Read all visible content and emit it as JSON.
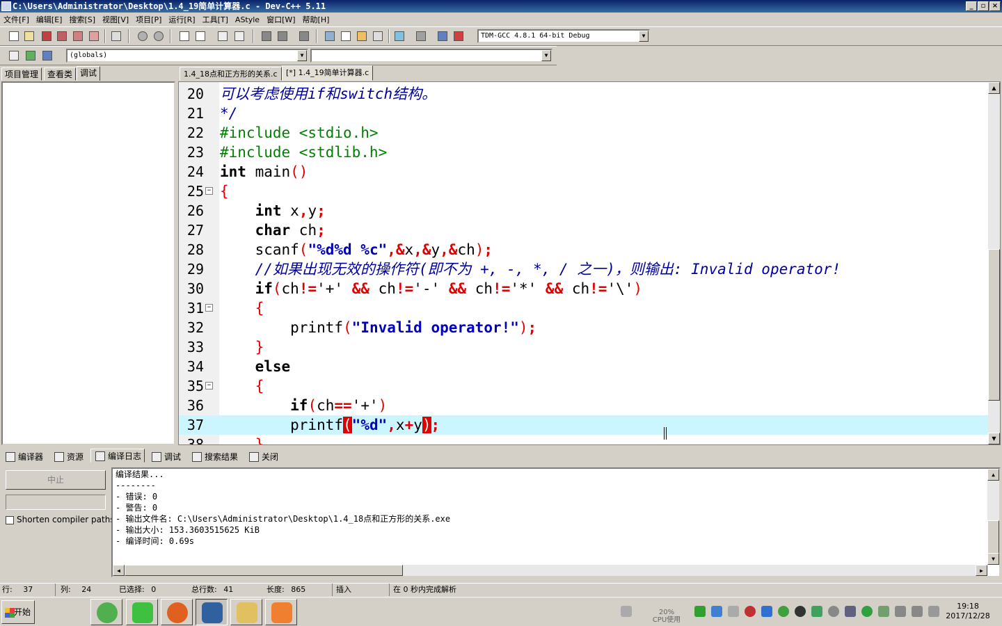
{
  "window": {
    "title": "C:\\Users\\Administrator\\Desktop\\1.4_19简单计算器.c - Dev-C++ 5.11"
  },
  "menu": [
    "文件[F]",
    "编辑[E]",
    "搜索[S]",
    "视图[V]",
    "项目[P]",
    "运行[R]",
    "工具[T]",
    "AStyle",
    "窗口[W]",
    "帮助[H]"
  ],
  "toolbar": {
    "compiler_select": "TDM-GCC 4.8.1 64-bit Debug",
    "scope_select": "(globals)",
    "member_select": ""
  },
  "left_tabs": [
    "项目管理",
    "查看类",
    "调试"
  ],
  "editor_tabs": [
    "1.4_18点和正方形的关系.c",
    "[*] 1.4_19简单计算器.c"
  ],
  "code_lines": [
    {
      "n": "20",
      "fold": ""
    },
    {
      "n": "21",
      "fold": ""
    },
    {
      "n": "22",
      "fold": ""
    },
    {
      "n": "23",
      "fold": ""
    },
    {
      "n": "24",
      "fold": ""
    },
    {
      "n": "25",
      "fold": "−"
    },
    {
      "n": "26",
      "fold": ""
    },
    {
      "n": "27",
      "fold": ""
    },
    {
      "n": "28",
      "fold": ""
    },
    {
      "n": "29",
      "fold": ""
    },
    {
      "n": "30",
      "fold": ""
    },
    {
      "n": "31",
      "fold": "−"
    },
    {
      "n": "32",
      "fold": ""
    },
    {
      "n": "33",
      "fold": ""
    },
    {
      "n": "34",
      "fold": ""
    },
    {
      "n": "35",
      "fold": "−"
    },
    {
      "n": "36",
      "fold": ""
    },
    {
      "n": "37",
      "fold": ""
    },
    {
      "n": "38",
      "fold": ""
    }
  ],
  "code_text": {
    "l20": "可以考虑使用if和switch结构。",
    "l21": "*/",
    "l22": "#include <stdio.h>",
    "l23": "#include <stdlib.h>",
    "l29": "//如果出现无效的操作符(即不为 +, -, *, / 之一)，则输出: Invalid operator!",
    "l32_str": "\"Invalid operator!\""
  },
  "bottom_tabs": [
    "编译器",
    "资源",
    "编译日志",
    "调试",
    "搜索结果",
    "关闭"
  ],
  "compile_panel": {
    "abort_label": "中止",
    "shorten_label": "Shorten compiler paths",
    "log": [
      "编译结果...",
      "--------",
      "- 错误: 0",
      "- 警告: 0",
      "- 输出文件名: C:\\Users\\Administrator\\Desktop\\1.4_18点和正方形的关系.exe",
      "- 输出大小: 153.3603515625 KiB",
      "- 编译时间: 0.69s"
    ]
  },
  "status": {
    "row_label": "行:",
    "row": "37",
    "col_label": "列:",
    "col": "24",
    "sel_label": "已选择:",
    "sel": "0",
    "lines_label": "总行数:",
    "lines": "41",
    "len_label": "长度:",
    "len": "865",
    "mode": "插入",
    "parse": "在 0 秒内完成解析"
  },
  "taskbar": {
    "start_label": "开始",
    "cpu_percent": "20%",
    "cpu_label": "CPU使用",
    "time": "19:18",
    "date": "2017/12/28"
  }
}
